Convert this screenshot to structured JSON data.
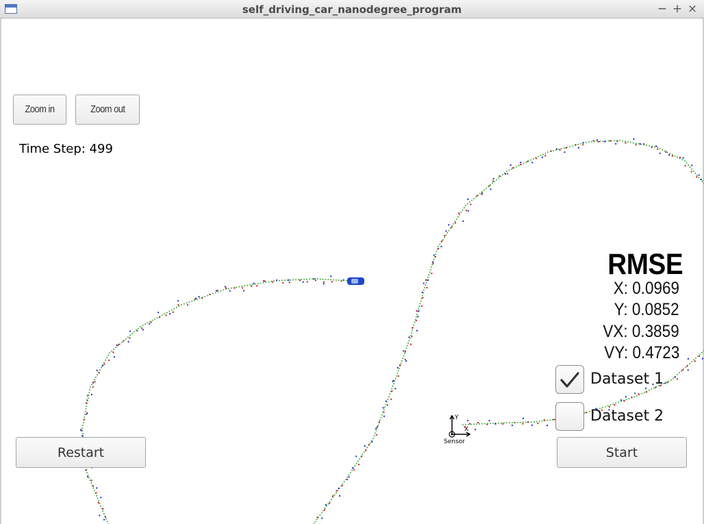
{
  "window": {
    "title": "self_driving_car_nanodegree_program",
    "minimize": "−",
    "maximize": "+",
    "close": "×"
  },
  "controls": {
    "zoom_in": "Zoom in",
    "zoom_out": "Zoom out",
    "restart": "Restart",
    "start": "Start"
  },
  "status": {
    "time_step": "Time Step: 499"
  },
  "rmse": {
    "title": "RMSE",
    "x": "X: 0.0969",
    "y": "Y: 0.0852",
    "vx": "VX: 0.3859",
    "vy": "VY: 0.4723"
  },
  "datasets": [
    {
      "label": "Dataset 1",
      "checked": true
    },
    {
      "label": "Dataset 2",
      "checked": false
    }
  ],
  "sensor": {
    "label": "Sensor",
    "x_axis": "X",
    "y_axis": "Y"
  },
  "colors": {
    "track_estimate": "#1aa01a",
    "lidar_marker": "#d01818",
    "radar_marker": "#1a2ad0",
    "car": "#1f47c8"
  }
}
